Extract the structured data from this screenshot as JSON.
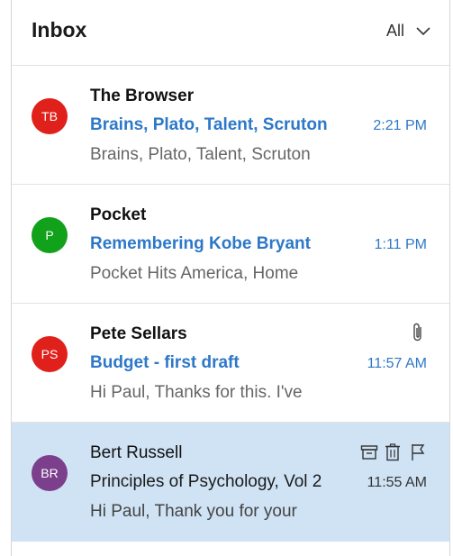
{
  "header": {
    "title": "Inbox",
    "filter_label": "All"
  },
  "colors": {
    "accent": "#2d78c8",
    "selected_bg": "#cfe3f5",
    "avatar_tb": "#e0201b",
    "avatar_p": "#11a11a",
    "avatar_ps": "#e0201b",
    "avatar_br": "#7b3f8c"
  },
  "messages": [
    {
      "initials": "TB",
      "sender": "The Browser",
      "subject": "Brains, Plato, Talent, Scruton",
      "time": "2:21 PM",
      "preview": "Brains, Plato, Talent, Scruton",
      "unread": true
    },
    {
      "initials": "P",
      "sender": "Pocket",
      "subject": "Remembering Kobe Bryant",
      "time": "1:11 PM",
      "preview": "Pocket Hits America, Home",
      "unread": true
    },
    {
      "initials": "PS",
      "sender": "Pete Sellars",
      "subject": "Budget - first draft",
      "time": "11:57 AM",
      "preview": "Hi Paul, Thanks for this. I've",
      "unread": true,
      "icons": [
        "paperclip-icon"
      ]
    },
    {
      "initials": "BR",
      "sender": "Bert Russell",
      "subject": "Principles of Psychology, Vol 2",
      "time": "11:55 AM",
      "preview": "Hi Paul, Thank you for your",
      "unread": false,
      "selected": true,
      "icons": [
        "archive-icon",
        "delete-icon",
        "flag-icon"
      ]
    }
  ]
}
